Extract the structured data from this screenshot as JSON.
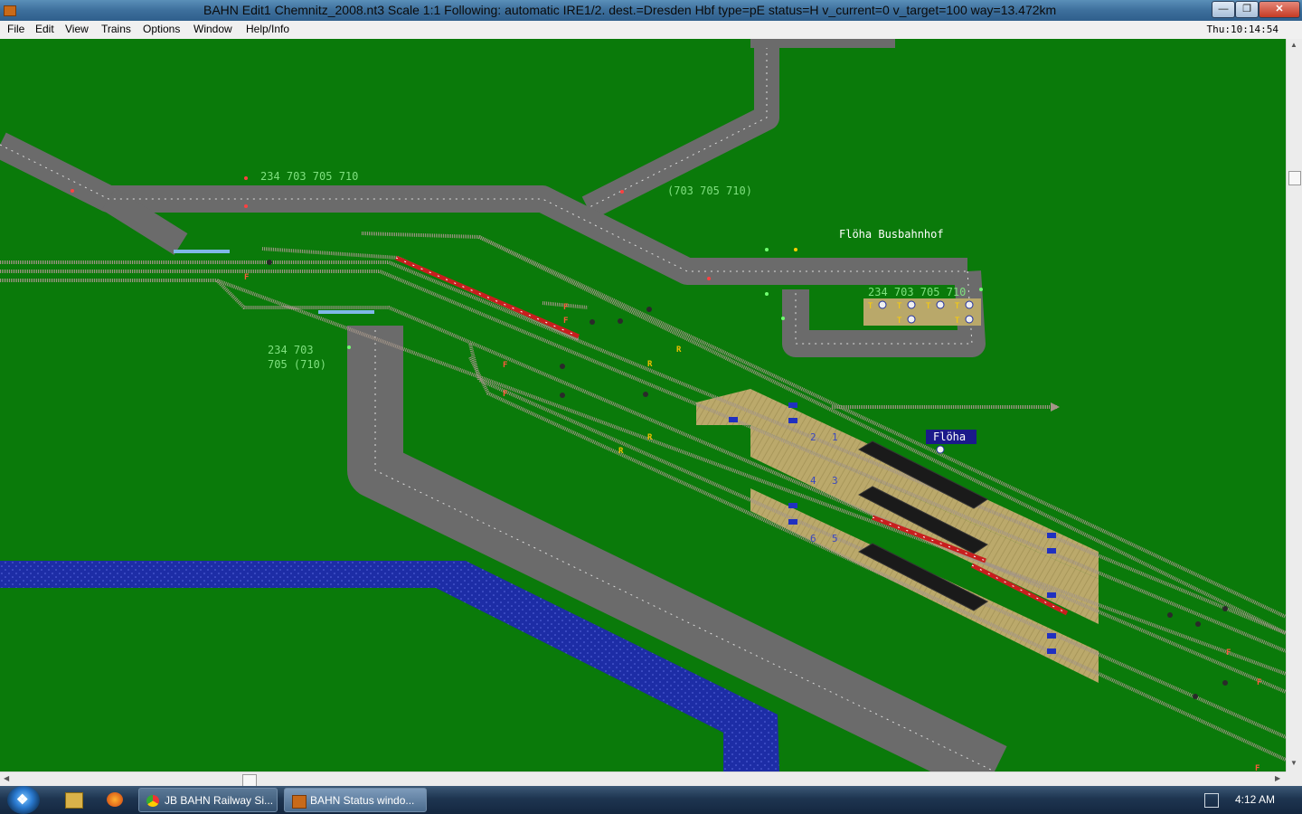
{
  "window": {
    "title": "BAHN Edit1 Chemnitz_2008.nt3 Scale 1:1 Following: automatic IRE1/2.  dest.=Dresden Hbf type=pE status=H  v_current=0 v_target=100 way=13.472km",
    "controls": [
      "minimize",
      "maximize",
      "close"
    ]
  },
  "menu": {
    "items": [
      "File",
      "Edit",
      "View",
      "Trains",
      "Options",
      "Window",
      "Help/Info"
    ],
    "clock": "Thu:10:14:54"
  },
  "map": {
    "labels": {
      "route_top": "234 703 705 710",
      "route_top_right": "(703 705 710)",
      "bus_station": "Flöha Busbahnhof",
      "bus_routes": "234 703 705 710",
      "route_left_1": "234 703",
      "route_left_2": "705 (710)",
      "station_name": "Flöha"
    },
    "platform_numbers": [
      "2",
      "1",
      "4",
      "3",
      "6",
      "5"
    ]
  },
  "taskbar": {
    "tasks": [
      {
        "label": "JB BAHN Railway Si...",
        "icon": "chrome-icon",
        "active": false
      },
      {
        "label": "BAHN Status windo...",
        "icon": "train-icon",
        "active": true
      }
    ],
    "time": "4:12 AM"
  },
  "colors": {
    "grass": "#0a7a0a",
    "road": "#6e6e6e",
    "water": "#1f2fa8",
    "platform": "#b9a86a",
    "track": "#9b8f82",
    "label_green": "#7fe07f",
    "train_red": "#d42020"
  }
}
